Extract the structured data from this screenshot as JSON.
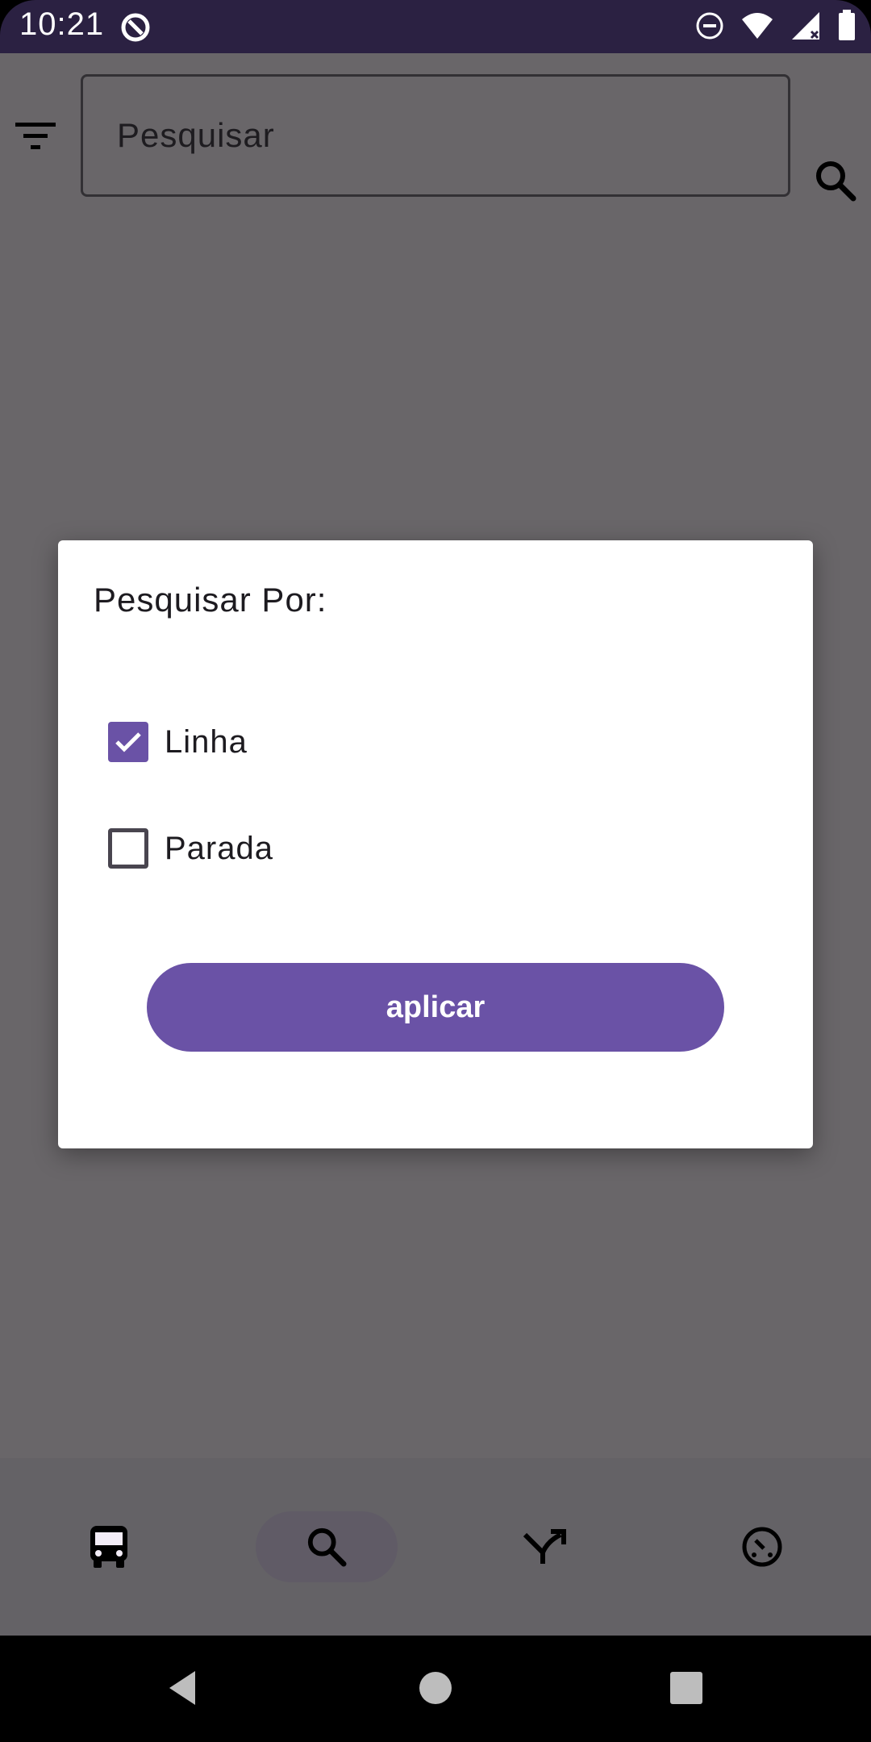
{
  "status_bar": {
    "time": "10:21",
    "icons": [
      "sync-badge-icon",
      "do-not-disturb-icon",
      "wifi-icon",
      "signal-icon",
      "battery-icon"
    ]
  },
  "search": {
    "placeholder": "Pesquisar"
  },
  "dialog": {
    "title": "Pesquisar Por:",
    "options": [
      {
        "label": "Linha",
        "checked": true
      },
      {
        "label": "Parada",
        "checked": false
      }
    ],
    "apply_label": "aplicar"
  },
  "bottom_nav": {
    "items": [
      {
        "icon": "bus-icon",
        "active": false
      },
      {
        "icon": "search-icon",
        "active": true
      },
      {
        "icon": "route-split-icon",
        "active": false
      },
      {
        "icon": "timer-icon",
        "active": false
      }
    ]
  },
  "colors": {
    "accent": "#6a52a6",
    "status_bar": "#2b2142",
    "surface": "#fef7ff"
  }
}
